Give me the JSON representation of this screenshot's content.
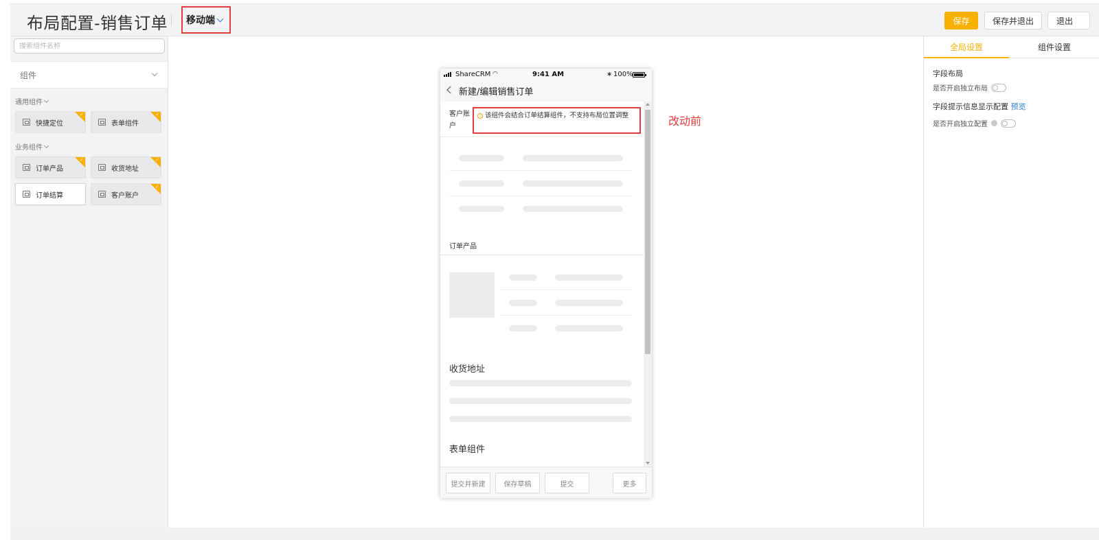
{
  "header": {
    "title": "布局配置-销售订单",
    "mode": "移动端",
    "buttons": {
      "save": "保存",
      "save_exit": "保存并退出",
      "exit": "退出"
    }
  },
  "left_panel": {
    "search_placeholder": "搜索组件名称",
    "components_header": "组件",
    "groups": [
      {
        "title": "通用组件",
        "items": [
          "快捷定位",
          "表单组件"
        ]
      },
      {
        "title": "业务组件",
        "items": [
          "订单产品",
          "收货地址",
          "订单结算",
          "客户账户"
        ]
      }
    ]
  },
  "phone": {
    "status": {
      "carrier": "ShareCRM",
      "time": "9:41 AM",
      "battery": "100%"
    },
    "nav_title": "新建/编辑销售订单",
    "customer_account_label": "客户账户",
    "warning_text": "该组件会结合订单结算组件，不支持布局位置调整",
    "sections": {
      "order_products": "订单产品",
      "shipping_address": "收货地址",
      "form_component": "表单组件"
    },
    "footer_buttons": {
      "submit_new": "提交并新建",
      "save_draft": "保存草稿",
      "submit": "提交",
      "more": "更多"
    }
  },
  "annotation": "改动前",
  "right_panel": {
    "tabs": {
      "global": "全局设置",
      "component": "组件设置"
    },
    "field_layout_title": "字段布局",
    "independent_layout_label": "是否开启独立布局",
    "hint_config_title": "字段提示信息显示配置",
    "preview_link": "预览",
    "independent_config_label": "是否开启独立配置"
  },
  "colors": {
    "accent": "#f8b003",
    "highlight_red": "#e23c3c",
    "link_blue": "#2f7bd6"
  }
}
